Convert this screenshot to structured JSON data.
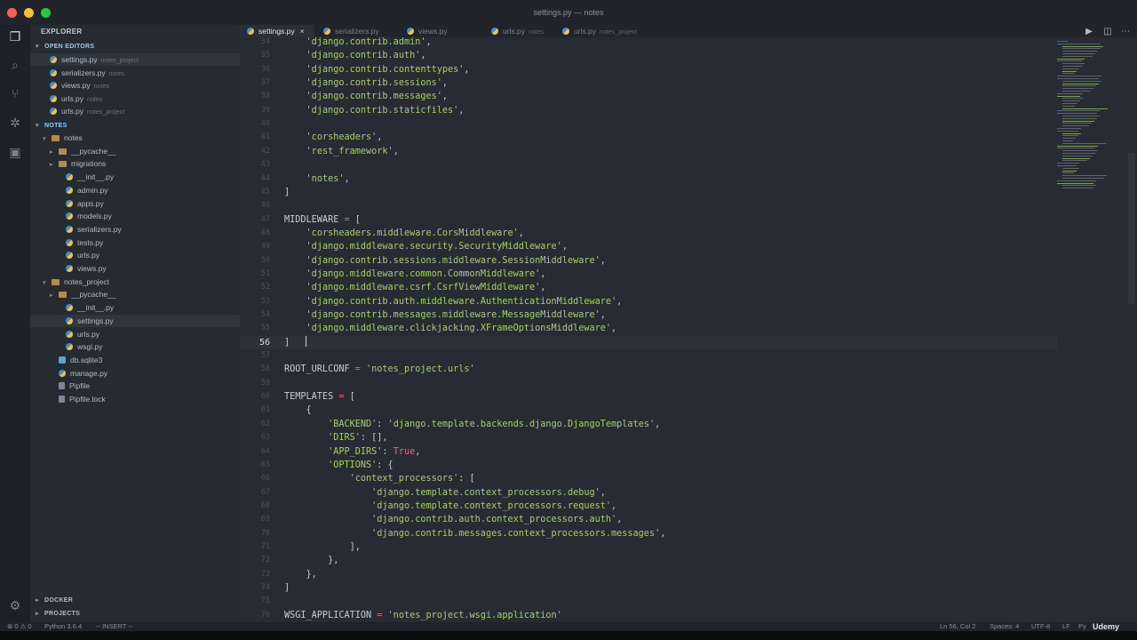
{
  "window": {
    "title": "settings.py — notes"
  },
  "sidebar": {
    "header": "EXPLORER",
    "open_editors_label": "OPEN EDITORS",
    "open_editors": [
      {
        "name": "settings.py",
        "sub": "notes_project",
        "active": true
      },
      {
        "name": "serializers.py",
        "sub": "notes"
      },
      {
        "name": "views.py",
        "sub": "notes"
      },
      {
        "name": "urls.py",
        "sub": "notes"
      },
      {
        "name": "urls.py",
        "sub": "notes_project"
      }
    ],
    "project_label": "NOTES",
    "tree": [
      {
        "name": "notes",
        "type": "folder",
        "depth": 1,
        "open": true
      },
      {
        "name": "__pycache__",
        "type": "folder",
        "depth": 2
      },
      {
        "name": "migrations",
        "type": "folder",
        "depth": 2
      },
      {
        "name": "__init__.py",
        "type": "py",
        "depth": 3
      },
      {
        "name": "admin.py",
        "type": "py",
        "depth": 3
      },
      {
        "name": "apps.py",
        "type": "py",
        "depth": 3
      },
      {
        "name": "models.py",
        "type": "py",
        "depth": 3
      },
      {
        "name": "serializers.py",
        "type": "py",
        "depth": 3
      },
      {
        "name": "tests.py",
        "type": "py",
        "depth": 3
      },
      {
        "name": "urls.py",
        "type": "py",
        "depth": 3
      },
      {
        "name": "views.py",
        "type": "py",
        "depth": 3
      },
      {
        "name": "notes_project",
        "type": "folder",
        "depth": 1,
        "open": true
      },
      {
        "name": "__pycache__",
        "type": "folder",
        "depth": 2
      },
      {
        "name": "__init__.py",
        "type": "py",
        "depth": 3
      },
      {
        "name": "settings.py",
        "type": "py",
        "depth": 3,
        "active": true
      },
      {
        "name": "urls.py",
        "type": "py",
        "depth": 3
      },
      {
        "name": "wsgi.py",
        "type": "py",
        "depth": 3
      },
      {
        "name": "db.sqlite3",
        "type": "db",
        "depth": 2
      },
      {
        "name": "manage.py",
        "type": "py",
        "depth": 2
      },
      {
        "name": "Pipfile",
        "type": "file",
        "depth": 2
      },
      {
        "name": "Pipfile.lock",
        "type": "file",
        "depth": 2
      }
    ],
    "docker_label": "DOCKER",
    "projects_label": "PROJECTS"
  },
  "tabs": [
    {
      "name": "settings.py",
      "sub": "",
      "active": true,
      "close": "×"
    },
    {
      "name": "serializers.py",
      "sub": ""
    },
    {
      "name": "views.py",
      "sub": ""
    },
    {
      "name": "urls.py",
      "sub": "notes"
    },
    {
      "name": "urls.py",
      "sub": "notes_project"
    }
  ],
  "editor": {
    "current_line": "56",
    "lines": [
      {
        "n": "34",
        "t": [
          [
            "    ",
            "p"
          ],
          [
            "'django.contrib.admin'",
            "s"
          ],
          [
            ",",
            "p"
          ]
        ]
      },
      {
        "n": "35",
        "t": [
          [
            "    ",
            "p"
          ],
          [
            "'django.contrib.auth'",
            "s"
          ],
          [
            ",",
            "p"
          ]
        ]
      },
      {
        "n": "36",
        "t": [
          [
            "    ",
            "p"
          ],
          [
            "'django.contrib.contenttypes'",
            "s"
          ],
          [
            ",",
            "p"
          ]
        ]
      },
      {
        "n": "37",
        "t": [
          [
            "    ",
            "p"
          ],
          [
            "'django.contrib.sessions'",
            "s"
          ],
          [
            ",",
            "p"
          ]
        ]
      },
      {
        "n": "38",
        "t": [
          [
            "    ",
            "p"
          ],
          [
            "'django.contrib.messages'",
            "s"
          ],
          [
            ",",
            "p"
          ]
        ]
      },
      {
        "n": "39",
        "t": [
          [
            "    ",
            "p"
          ],
          [
            "'django.contrib.staticfiles'",
            "s"
          ],
          [
            ",",
            "p"
          ]
        ]
      },
      {
        "n": "40",
        "t": []
      },
      {
        "n": "41",
        "t": [
          [
            "    ",
            "p"
          ],
          [
            "'corsheaders'",
            "s"
          ],
          [
            ",",
            "p"
          ]
        ]
      },
      {
        "n": "42",
        "t": [
          [
            "    ",
            "p"
          ],
          [
            "'rest_framework'",
            "s"
          ],
          [
            ",",
            "p"
          ]
        ]
      },
      {
        "n": "43",
        "t": []
      },
      {
        "n": "44",
        "t": [
          [
            "    ",
            "p"
          ],
          [
            "'notes'",
            "s"
          ],
          [
            ",",
            "p"
          ]
        ]
      },
      {
        "n": "45",
        "t": [
          [
            "]",
            "p"
          ]
        ]
      },
      {
        "n": "46",
        "t": []
      },
      {
        "n": "47",
        "t": [
          [
            "MIDDLEWARE",
            "n"
          ],
          [
            " = ",
            "k"
          ],
          [
            "[",
            "p"
          ]
        ]
      },
      {
        "n": "48",
        "t": [
          [
            "    ",
            "p"
          ],
          [
            "'corsheaders.middleware.CorsMiddleware'",
            "s"
          ],
          [
            ",",
            "p"
          ]
        ]
      },
      {
        "n": "49",
        "t": [
          [
            "    ",
            "p"
          ],
          [
            "'django.middleware.security.SecurityMiddleware'",
            "s"
          ],
          [
            ",",
            "p"
          ]
        ]
      },
      {
        "n": "50",
        "t": [
          [
            "    ",
            "p"
          ],
          [
            "'django.contrib.sessions.middleware.SessionMiddleware'",
            "s"
          ],
          [
            ",",
            "p"
          ]
        ]
      },
      {
        "n": "51",
        "t": [
          [
            "    ",
            "p"
          ],
          [
            "'django.middleware.common.CommonMiddleware'",
            "s"
          ],
          [
            ",",
            "p"
          ]
        ]
      },
      {
        "n": "52",
        "t": [
          [
            "    ",
            "p"
          ],
          [
            "'django.middleware.csrf.CsrfViewMiddleware'",
            "s"
          ],
          [
            ",",
            "p"
          ]
        ]
      },
      {
        "n": "53",
        "t": [
          [
            "    ",
            "p"
          ],
          [
            "'django.contrib.auth.middleware.AuthenticationMiddleware'",
            "s"
          ],
          [
            ",",
            "p"
          ]
        ]
      },
      {
        "n": "54",
        "t": [
          [
            "    ",
            "p"
          ],
          [
            "'django.contrib.messages.middleware.MessageMiddleware'",
            "s"
          ],
          [
            ",",
            "p"
          ]
        ]
      },
      {
        "n": "55",
        "t": [
          [
            "    ",
            "p"
          ],
          [
            "'django.middleware.clickjacking.XFrameOptionsMiddleware'",
            "s"
          ],
          [
            ",",
            "p"
          ]
        ]
      },
      {
        "n": "56",
        "t": [
          [
            "]",
            "p"
          ]
        ]
      },
      {
        "n": "57",
        "t": []
      },
      {
        "n": "58",
        "t": [
          [
            "ROOT_URLCONF",
            "n"
          ],
          [
            " = ",
            "k"
          ],
          [
            "'notes_project.urls'",
            "s"
          ]
        ]
      },
      {
        "n": "59",
        "t": []
      },
      {
        "n": "60",
        "t": [
          [
            "TEMPLATES",
            "n"
          ],
          [
            " = ",
            "k"
          ],
          [
            "[",
            "p"
          ]
        ]
      },
      {
        "n": "61",
        "t": [
          [
            "    {",
            "p"
          ]
        ]
      },
      {
        "n": "62",
        "t": [
          [
            "        ",
            "p"
          ],
          [
            "'BACKEND'",
            "s"
          ],
          [
            ": ",
            "p"
          ],
          [
            "'django.template.backends.django.DjangoTemplates'",
            "s"
          ],
          [
            ",",
            "p"
          ]
        ]
      },
      {
        "n": "63",
        "t": [
          [
            "        ",
            "p"
          ],
          [
            "'DIRS'",
            "s"
          ],
          [
            ": [],",
            "p"
          ]
        ]
      },
      {
        "n": "64",
        "t": [
          [
            "        ",
            "p"
          ],
          [
            "'APP_DIRS'",
            "s"
          ],
          [
            ": ",
            "p"
          ],
          [
            "True",
            "k"
          ],
          [
            ",",
            "p"
          ]
        ]
      },
      {
        "n": "65",
        "t": [
          [
            "        ",
            "p"
          ],
          [
            "'OPTIONS'",
            "s"
          ],
          [
            ": {",
            "p"
          ]
        ]
      },
      {
        "n": "66",
        "t": [
          [
            "            ",
            "p"
          ],
          [
            "'context_processors'",
            "s"
          ],
          [
            ": [",
            "p"
          ]
        ]
      },
      {
        "n": "67",
        "t": [
          [
            "                ",
            "p"
          ],
          [
            "'django.template.context_processors.debug'",
            "s"
          ],
          [
            ",",
            "p"
          ]
        ]
      },
      {
        "n": "68",
        "t": [
          [
            "                ",
            "p"
          ],
          [
            "'django.template.context_processors.request'",
            "s"
          ],
          [
            ",",
            "p"
          ]
        ]
      },
      {
        "n": "69",
        "t": [
          [
            "                ",
            "p"
          ],
          [
            "'django.contrib.auth.context_processors.auth'",
            "s"
          ],
          [
            ",",
            "p"
          ]
        ]
      },
      {
        "n": "70",
        "t": [
          [
            "                ",
            "p"
          ],
          [
            "'django.contrib.messages.context_processors.messages'",
            "s"
          ],
          [
            ",",
            "p"
          ]
        ]
      },
      {
        "n": "71",
        "t": [
          [
            "            ],",
            "p"
          ]
        ]
      },
      {
        "n": "72",
        "t": [
          [
            "        },",
            "p"
          ]
        ]
      },
      {
        "n": "73",
        "t": [
          [
            "    },",
            "p"
          ]
        ]
      },
      {
        "n": "74",
        "t": [
          [
            "]",
            "p"
          ]
        ]
      },
      {
        "n": "75",
        "t": []
      },
      {
        "n": "76",
        "t": [
          [
            "WSGI_APPLICATION",
            "n"
          ],
          [
            " = ",
            "k"
          ],
          [
            "'notes_project.wsgi.application'",
            "s"
          ]
        ]
      }
    ]
  },
  "statusbar": {
    "problems": "⊗ 0 ⚠ 0",
    "python": "Python 3.6.4",
    "mode": "-- INSERT --",
    "position": "Ln 56, Col 2",
    "spaces": "Spaces: 4",
    "encoding": "UTF-8",
    "eol": "LF",
    "language": "Py",
    "brand": "Udemy"
  },
  "colors": {
    "accent": "#8bd0ff",
    "string": "#a5d06a",
    "operator": "#e06c75"
  }
}
